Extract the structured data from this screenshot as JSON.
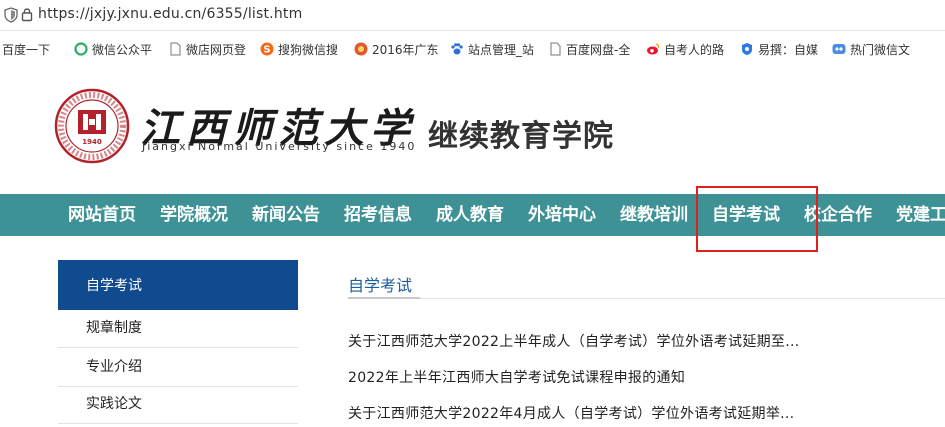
{
  "browser": {
    "url": "https://jxjy.jxnu.edu.cn/6355/list.htm"
  },
  "bookmarks": [
    {
      "label": "百度一下",
      "icon": "none-icon"
    },
    {
      "label": "微信公众平",
      "icon": "wechat-icon"
    },
    {
      "label": "微店网页登",
      "icon": "page-icon"
    },
    {
      "label": "搜狗微信搜",
      "icon": "sogou-icon"
    },
    {
      "label": "2016年广东",
      "icon": "orange-circle-icon"
    },
    {
      "label": "站点管理_站",
      "icon": "paw-icon"
    },
    {
      "label": "百度网盘-全",
      "icon": "page-icon"
    },
    {
      "label": "自考人的路",
      "icon": "weibo-icon"
    },
    {
      "label": "易撰：自媒",
      "icon": "yizhuan-icon"
    },
    {
      "label": "热门微信文",
      "icon": "eye-icon"
    }
  ],
  "header": {
    "logo_cn": "江西师范大学",
    "logo_en": "Jiangxi Normal University since 1940",
    "seal_text": "1940",
    "college": "继续教育学院"
  },
  "nav": {
    "items": [
      "网站首页",
      "学院概况",
      "新闻公告",
      "招考信息",
      "成人教育",
      "外培中心",
      "继教培训",
      "自学考试",
      "校企合作",
      "党建工"
    ],
    "highlighted": "自学考试"
  },
  "sidebar": {
    "active": "自学考试",
    "items": [
      "规章制度",
      "专业介绍",
      "实践论文"
    ]
  },
  "main": {
    "title": "自学考试",
    "news": [
      "关于江西师范大学2022上半年成人（自学考试）学位外语考试延期至...",
      "2022年上半年江西师大自学考试免试课程申报的通知",
      "关于江西师范大学2022年4月成人（自学考试）学位外语考试延期举..."
    ]
  },
  "colors": {
    "nav_bg": "#3e9296",
    "sidebar_active_bg": "#104a8f",
    "highlight_border": "#e02020",
    "title_blue": "#1c5e9a"
  }
}
